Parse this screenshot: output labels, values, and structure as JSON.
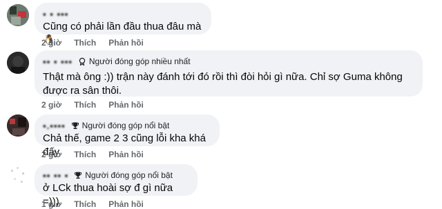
{
  "comments": [
    {
      "author": "▪ ▪ ▪▪▪",
      "badge": "",
      "text": "Cũng có phải lần đầu thua đâu mà 🐧",
      "time": "2 giờ",
      "like": "Thích",
      "reply": "Phản hồi"
    },
    {
      "author": "▪▪ ▪ ▪▪▪",
      "badge": "Người đóng góp nhiều nhất",
      "text": "Thật mà ông :)) trận này đánh tới đó rồi thì đòi hỏi gì nữa. Chỉ sợ Guma không được ra sân thôi.",
      "time": "2 giờ",
      "like": "Thích",
      "reply": "Phản hồi"
    },
    {
      "author": "▪.▪▪▪▪",
      "badge": "Người đóng góp nổi bật",
      "text": "Chả thế, game 2 3 cũng lỗi kha khá đấy",
      "time": "2 giờ",
      "like": "Thích",
      "reply": "Phản hồi"
    },
    {
      "author": "▪▪ ▪▪ ▪",
      "badge": "Người đóng góp nổi bật",
      "text": "ở LCk thua hoài sợ đ gì nữa =)))",
      "time": "1 giờ",
      "like": "Thích",
      "reply": "Phản hồi"
    }
  ],
  "colors": {
    "bubble": "#f0f2f5",
    "meta_text": "#65676b",
    "body_text": "#050505"
  }
}
